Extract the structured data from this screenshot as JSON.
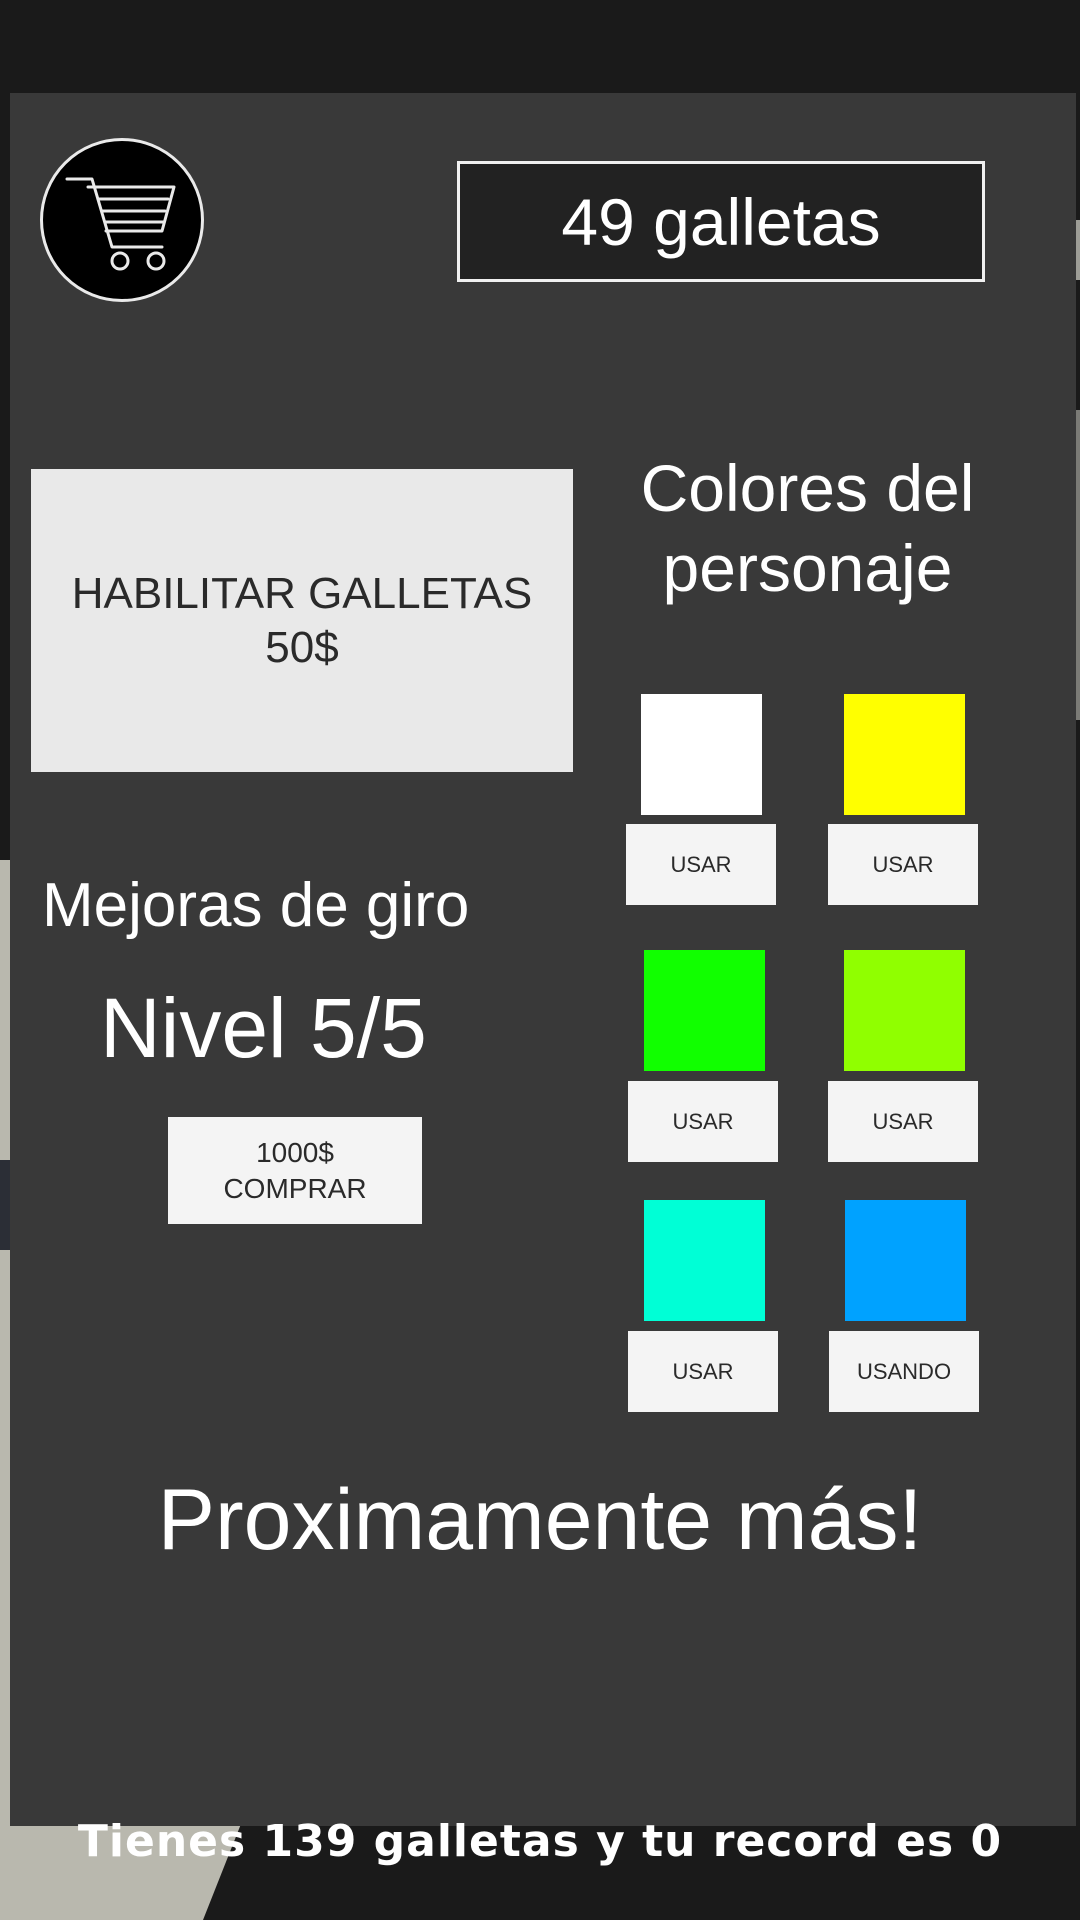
{
  "header": {
    "cart_icon": "shopping-cart-icon",
    "cookie_count": "49 galletas"
  },
  "enable_cookies": {
    "line1": "HABILITAR GALLETAS",
    "line2": "50$"
  },
  "character_colors": {
    "title_line1": "Colores del",
    "title_line2": "personaje",
    "swatches": [
      {
        "color": "#ffffff",
        "button_label": "USAR"
      },
      {
        "color": "#ffff00",
        "button_label": "USAR"
      },
      {
        "color": "#11ff00",
        "button_label": "USAR"
      },
      {
        "color": "#90ff00",
        "button_label": "USAR"
      },
      {
        "color": "#00ffd6",
        "button_label": "USAR"
      },
      {
        "color": "#00a2ff",
        "button_label": "USANDO"
      }
    ]
  },
  "spin_upgrades": {
    "title": "Mejoras de giro",
    "level": "Nivel 5/5",
    "price": "1000$",
    "buy_label": "COMPRAR"
  },
  "coming_soon": "Proximamente más!",
  "footer": "Tienes 139 galletas y tu record es 0"
}
